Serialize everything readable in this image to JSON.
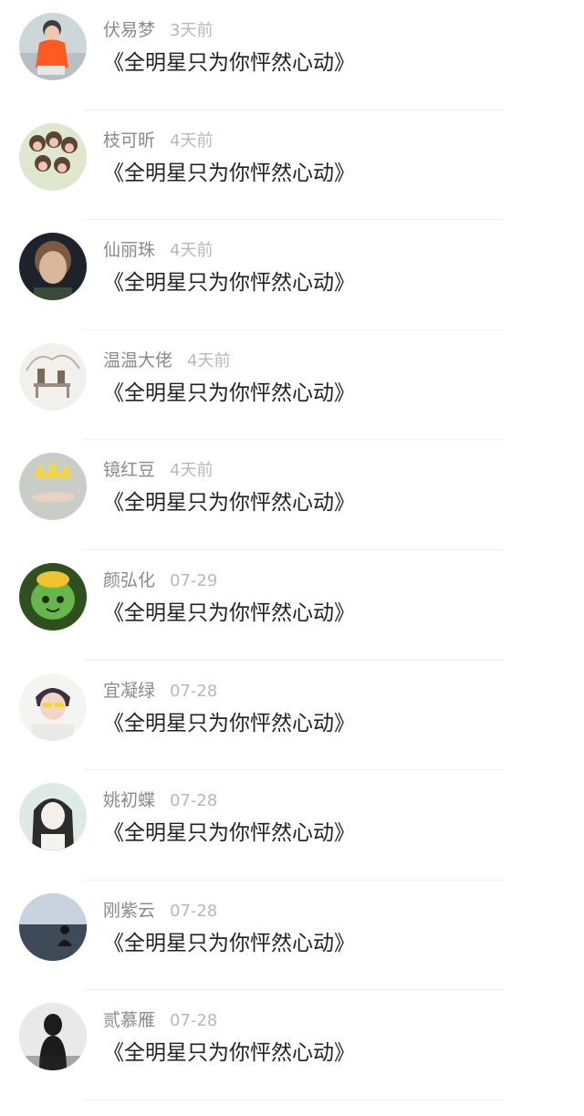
{
  "items": [
    {
      "name": "伏易梦",
      "time": "3天前",
      "title": "《全明星只为你怦然心动》",
      "avatar": {
        "icon": "avatar-icon",
        "bg": "#cdd7d8",
        "fg": "#ff5a1f",
        "accent": "#3d3d3d"
      }
    },
    {
      "name": "枝可昕",
      "time": "4天前",
      "title": "《全明星只为你怦然心动》",
      "avatar": {
        "icon": "avatar-icon",
        "bg": "#dfe8cf",
        "fg": "#5a4538",
        "accent": "#f1c6b1"
      }
    },
    {
      "name": "仙丽珠",
      "time": "4天前",
      "title": "《全明星只为你怦然心动》",
      "avatar": {
        "icon": "avatar-icon",
        "bg": "#1e232b",
        "fg": "#7d5a3f",
        "accent": "#d8b79a"
      }
    },
    {
      "name": "温温大佬",
      "time": "4天前",
      "title": "《全明星只为你怦然心动》",
      "avatar": {
        "icon": "avatar-icon",
        "bg": "#f1f0ec",
        "fg": "#7a6a58",
        "accent": "#b9b4aa"
      }
    },
    {
      "name": "镜红豆",
      "time": "4天前",
      "title": "《全明星只为你怦然心动》",
      "avatar": {
        "icon": "avatar-icon",
        "bg": "#c8cec7",
        "fg": "#f2d64a",
        "accent": "#e7d2c4"
      }
    },
    {
      "name": "颜弘化",
      "time": "07-29",
      "title": "《全明星只为你怦然心动》",
      "avatar": {
        "icon": "avatar-icon",
        "bg": "#2f4f1f",
        "fg": "#66b64b",
        "accent": "#f0c22e"
      }
    },
    {
      "name": "宜凝绿",
      "time": "07-28",
      "title": "《全明星只为你怦然心动》",
      "avatar": {
        "icon": "avatar-icon",
        "bg": "#f4f4f2",
        "fg": "#3d2f3c",
        "accent": "#f2d638"
      }
    },
    {
      "name": "姚初蝶",
      "time": "07-28",
      "title": "《全明星只为你怦然心动》",
      "avatar": {
        "icon": "avatar-icon",
        "bg": "#dfe9e6",
        "fg": "#2c2c2c",
        "accent": "#f6efe9"
      }
    },
    {
      "name": "刚紫云",
      "time": "07-28",
      "title": "《全明星只为你怦然心动》",
      "avatar": {
        "icon": "avatar-icon",
        "bg": "#5e6f86",
        "fg": "#14161a",
        "accent": "#c9d2df"
      }
    },
    {
      "name": "贰慕雁",
      "time": "07-28",
      "title": "《全明星只为你怦然心动》",
      "avatar": {
        "icon": "avatar-icon",
        "bg": "#bdbdbd",
        "fg": "#1c1c1c",
        "accent": "#f0f0f0"
      }
    }
  ]
}
